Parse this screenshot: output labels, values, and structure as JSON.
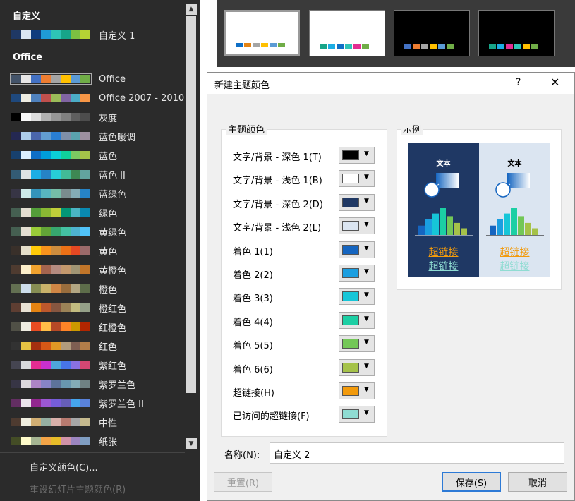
{
  "menu": {
    "custom_section": "自定义",
    "office_section": "Office",
    "items": [
      {
        "label": "自定义 1",
        "colors": [
          "#1f3864",
          "#dbe5f1",
          "#0f3b7d",
          "#1f9ad6",
          "#2ec4b6",
          "#17a589",
          "#7cc142",
          "#b5d334"
        ]
      },
      {
        "label": "Office",
        "colors": [
          "#44546a",
          "#e7e6e6",
          "#4472c4",
          "#ed7d31",
          "#a5a5a5",
          "#ffc000",
          "#5b9bd5",
          "#70ad47"
        ]
      },
      {
        "label": "Office 2007 - 2010",
        "colors": [
          "#1f497d",
          "#eeece1",
          "#4f81bd",
          "#c0504d",
          "#9bbb59",
          "#8064a2",
          "#4bacc6",
          "#f79646"
        ]
      },
      {
        "label": "灰度",
        "colors": [
          "#000000",
          "#f8f8f8",
          "#dddddd",
          "#b2b2b2",
          "#969696",
          "#808080",
          "#5f5f5f",
          "#4d4d4d"
        ]
      },
      {
        "label": "蓝色暖调",
        "colors": [
          "#242852",
          "#acccea",
          "#4a66ac",
          "#629dd1",
          "#297fd5",
          "#7f8fa9",
          "#5aa2ae",
          "#9d90a0"
        ]
      },
      {
        "label": "蓝色",
        "colors": [
          "#17406d",
          "#dbefff",
          "#0f6fc6",
          "#009dd9",
          "#0bd0d9",
          "#10cf9b",
          "#7cca62",
          "#a5c249"
        ]
      },
      {
        "label": "蓝色 II",
        "colors": [
          "#335b74",
          "#dfe3e5",
          "#1cade4",
          "#2683c6",
          "#27ced7",
          "#42ba97",
          "#3e8853",
          "#62a39f"
        ]
      },
      {
        "label": "蓝绿色",
        "colors": [
          "#373545",
          "#ceeae9",
          "#3494ba",
          "#58b6c0",
          "#75bda7",
          "#7a8c8e",
          "#84acb6",
          "#2683c6"
        ]
      },
      {
        "label": "绿色",
        "colors": [
          "#455f51",
          "#e3ded1",
          "#549e39",
          "#8ab833",
          "#c0cf3a",
          "#029676",
          "#4ab5c4",
          "#0989b1"
        ]
      },
      {
        "label": "黄绿色",
        "colors": [
          "#455f51",
          "#e3ded1",
          "#99cb38",
          "#63a537",
          "#37a76f",
          "#44c1a3",
          "#4eb3cf",
          "#51c3f9"
        ]
      },
      {
        "label": "黄色",
        "colors": [
          "#39302a",
          "#e5dec9",
          "#ffca08",
          "#f8931d",
          "#ce8d3e",
          "#ec7016",
          "#e64823",
          "#9c6a6a"
        ]
      },
      {
        "label": "黄橙色",
        "colors": [
          "#4e3b30",
          "#fbeec9",
          "#f0a22e",
          "#a5644e",
          "#b58b80",
          "#c3986d",
          "#a19574",
          "#c17529"
        ]
      },
      {
        "label": "橙色",
        "colors": [
          "#637052",
          "#ccddea",
          "#868e54",
          "#c9b26a",
          "#d08645",
          "#996d3d",
          "#b2a682",
          "#5d6d4a"
        ]
      },
      {
        "label": "橙红色",
        "colors": [
          "#5e3e32",
          "#e8e1d3",
          "#e48312",
          "#bd582c",
          "#865640",
          "#9b8357",
          "#c2bc80",
          "#94a088"
        ]
      },
      {
        "label": "红橙色",
        "colors": [
          "#505046",
          "#eeece1",
          "#e84c22",
          "#ffbd47",
          "#b64926",
          "#ff8427",
          "#cc9900",
          "#b22600"
        ]
      },
      {
        "label": "红色",
        "colors": [
          "#323232",
          "#e5c243",
          "#a5300f",
          "#d55816",
          "#e19825",
          "#b19c7d",
          "#7f5f52",
          "#b27d49"
        ]
      },
      {
        "label": "紫红色",
        "colors": [
          "#454551",
          "#d8d9dc",
          "#e32d91",
          "#c830cc",
          "#4ea6dc",
          "#4775e7",
          "#8971e1",
          "#d54773"
        ]
      },
      {
        "label": "紫罗兰色",
        "colors": [
          "#373545",
          "#dcd8dc",
          "#ad84c6",
          "#8784c7",
          "#5d739a",
          "#6997af",
          "#84acb6",
          "#6f8183"
        ]
      },
      {
        "label": "紫罗兰色 II",
        "colors": [
          "#632e62",
          "#eae5eb",
          "#92278f",
          "#9b57d3",
          "#755dd9",
          "#665eb8",
          "#45a5ed",
          "#5982db"
        ]
      },
      {
        "label": "中性",
        "colors": [
          "#4e3b30",
          "#efedde",
          "#d1ae73",
          "#95afa2",
          "#d8b0aa",
          "#b87b70",
          "#a7a7a7",
          "#c6ba8e"
        ]
      },
      {
        "label": "纸张",
        "colors": [
          "#444d26",
          "#fefac9",
          "#a5b592",
          "#f3a447",
          "#e7bc29",
          "#d092a7",
          "#9c85c0",
          "#809ec2"
        ]
      }
    ],
    "customize_label": "自定义颜色(C)...",
    "reset_label": "重设幻灯片主题颜色(R)"
  },
  "thumbnails": [
    {
      "bg": "#ffffff",
      "selected": true,
      "colors": [
        "#0f6fc6",
        "#e48312",
        "#a5a5a5",
        "#ffc000",
        "#5b9bd5",
        "#70ad47"
      ]
    },
    {
      "bg": "#ffffff",
      "selected": false,
      "colors": [
        "#17a589",
        "#1cade4",
        "#0f6fc6",
        "#2ec4b6",
        "#e32d91",
        "#70ad47"
      ]
    },
    {
      "bg": "#000000",
      "selected": false,
      "colors": [
        "#4472c4",
        "#ed7d31",
        "#a5a5a5",
        "#ffc000",
        "#5b9bd5",
        "#70ad47"
      ]
    },
    {
      "bg": "#000000",
      "selected": false,
      "colors": [
        "#17a589",
        "#1cade4",
        "#e32d91",
        "#2ec4b6",
        "#ffc000",
        "#70ad47"
      ]
    }
  ],
  "dialog": {
    "title": "新建主题颜色",
    "help": "?",
    "close": "✕",
    "group_title": "主题颜色",
    "preview_title": "示例",
    "rows": [
      {
        "label": "文字/背景 - 深色 1(T)",
        "color": "#000000"
      },
      {
        "label": "文字/背景 - 浅色 1(B)",
        "color": "#ffffff"
      },
      {
        "label": "文字/背景 - 深色 2(D)",
        "color": "#1f3864"
      },
      {
        "label": "文字/背景 - 浅色 2(L)",
        "color": "#dbe5f1"
      },
      {
        "label": "着色 1(1)",
        "color": "#1565c0"
      },
      {
        "label": "着色 2(2)",
        "color": "#1a9ee0"
      },
      {
        "label": "着色 3(3)",
        "color": "#16c6d8"
      },
      {
        "label": "着色 4(4)",
        "color": "#1ccfa4"
      },
      {
        "label": "着色 5(5)",
        "color": "#73c757"
      },
      {
        "label": "着色 6(6)",
        "color": "#a5c249"
      },
      {
        "label": "超链接(H)",
        "color": "#f29a0c"
      },
      {
        "label": "已访问的超链接(F)",
        "color": "#8fdcd2"
      }
    ],
    "preview": {
      "text": "文本",
      "link": "超链接",
      "visited": "超链接",
      "dark_bg": "#1f3864",
      "light_bg": "#dbe5f1",
      "bar_heights": [
        0.35,
        0.6,
        0.8,
        1.0,
        0.7,
        0.45,
        0.25
      ]
    },
    "name_label": "名称(N):",
    "name_value": "自定义 2",
    "reset_btn": "重置(R)",
    "save_btn": "保存(S)",
    "cancel_btn": "取消"
  }
}
